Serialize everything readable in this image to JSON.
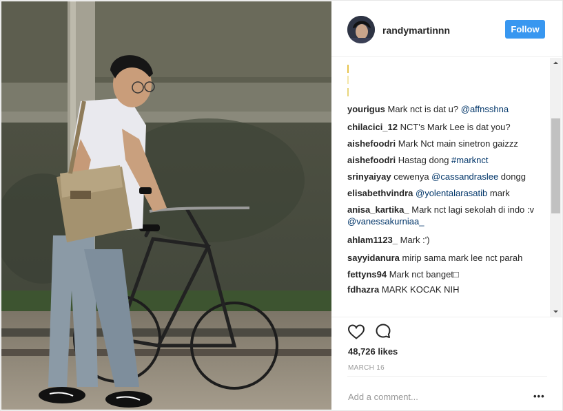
{
  "post": {
    "username": "randymartinnn",
    "follow_label": "Follow",
    "likes": "48,726 likes",
    "date": "MARCH 16",
    "comment_placeholder": "Add a comment...",
    "more_label": "•••"
  },
  "comments": [
    {
      "user": "yourigus",
      "parts": [
        {
          "text": "Mark nct is dat u? "
        },
        {
          "text": "@affnsshna",
          "link": true
        }
      ]
    },
    {
      "user": "chilacici_12",
      "parts": [
        {
          "text": "NCT's Mark Lee is dat you?"
        }
      ]
    },
    {
      "user": "aishefoodri",
      "parts": [
        {
          "text": "Mark Nct main sinetron gaizzz"
        }
      ]
    },
    {
      "user": "aishefoodri",
      "parts": [
        {
          "text": "Hastag dong "
        },
        {
          "text": "#marknct",
          "link": true
        }
      ]
    },
    {
      "user": "srinyaiyay",
      "parts": [
        {
          "text": "cewenya "
        },
        {
          "text": "@cassandraslee",
          "link": true
        },
        {
          "text": " dongg"
        }
      ]
    },
    {
      "user": "elisabethvindra",
      "parts": [
        {
          "text": "@yolentalarasatib",
          "link": true
        },
        {
          "text": " mark"
        }
      ]
    },
    {
      "user": "anisa_kartika_",
      "parts": [
        {
          "text": "Mark nct lagi sekolah di indo :v "
        },
        {
          "text": "@vanessakurniaa_",
          "link": true
        }
      ]
    },
    {
      "user": "ahlam1123_",
      "parts": [
        {
          "text": "Mark :')"
        }
      ]
    },
    {
      "user": "sayyidanura",
      "parts": [
        {
          "text": "mirip sama mark lee nct parah"
        }
      ]
    },
    {
      "user": "fettyns94",
      "parts": [
        {
          "text": "Mark nct banget□"
        }
      ]
    },
    {
      "user": "fdhazra",
      "parts": [
        {
          "text": "MARK KOCAK NIH"
        }
      ]
    }
  ],
  "colors": {
    "follow_button": "#3897f0",
    "link": "#003569",
    "muted": "#999999"
  },
  "icons": {
    "like": "heart-icon",
    "comment": "comment-bubble-icon",
    "scroll_up": "arrow-up-icon",
    "scroll_down": "arrow-down-icon"
  }
}
